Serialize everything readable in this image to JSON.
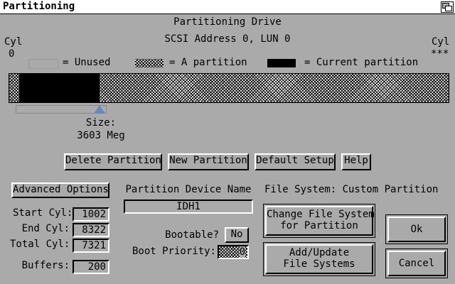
{
  "window": {
    "title": "Partitioning"
  },
  "header": {
    "title": "Partitioning Drive",
    "address": "SCSI Address 0, LUN 0",
    "cyl_left_label": "Cyl",
    "cyl_left_value": "0",
    "cyl_right_label": "Cyl",
    "cyl_right_value": "***"
  },
  "legend": {
    "unused": "= Unused",
    "a_partition": "= A partition",
    "current_partition": "= Current partition"
  },
  "partition_map": {
    "current_start_fraction": 0.022,
    "current_end_fraction": 0.205,
    "colors": {
      "unused": "#aaaaaa",
      "current": "#000000",
      "slider_arrow": "#6688bb"
    }
  },
  "size": {
    "label": "Size:",
    "value": "3603 Meg"
  },
  "buttons": {
    "delete_partition": "Delete Partition",
    "new_partition": "New Partition",
    "default_setup": "Default Setup",
    "help": "Help",
    "advanced_options": "Advanced Options",
    "change_fs_line1": "Change File System",
    "change_fs_line2": "for Partition",
    "add_update_line1": "Add/Update",
    "add_update_line2": "File Systems",
    "ok": "Ok",
    "cancel": "Cancel"
  },
  "fields": {
    "start_cyl_label": "Start Cyl:",
    "start_cyl": "1002",
    "end_cyl_label": "End Cyl:",
    "end_cyl": "8322",
    "total_cyl_label": "Total Cyl:",
    "total_cyl": "7321",
    "buffers_label": "Buffers:",
    "buffers": "200",
    "device_name_label": "Partition Device Name",
    "device_name": "IDH1",
    "bootable_label": "Bootable?",
    "bootable": "No",
    "boot_priority_label": "Boot Priority:",
    "boot_priority": "0"
  },
  "filesystem": {
    "label": "File System: Custom Partition"
  }
}
